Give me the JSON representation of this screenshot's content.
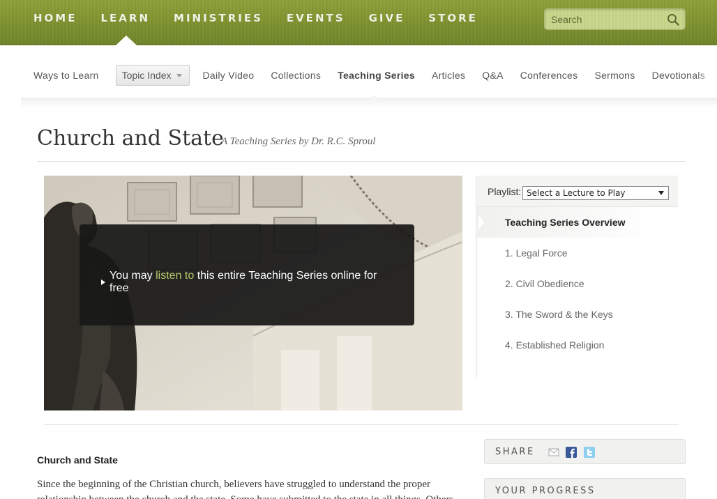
{
  "nav": {
    "items": [
      "HOME",
      "LEARN",
      "MINISTRIES",
      "EVENTS",
      "GIVE",
      "STORE"
    ],
    "search_placeholder": "Search"
  },
  "subnav": {
    "ways": "Ways to Learn",
    "topic": "Topic Index",
    "daily": "Daily Video",
    "collections": "Collections",
    "series": "Teaching Series",
    "articles": "Articles",
    "qa": "Q&A",
    "conferences": "Conferences",
    "sermons": "Sermons",
    "devotionals": "Devotionals"
  },
  "page": {
    "title": "Church and State",
    "subtitle": "A Teaching Series by Dr. R.C. Sproul"
  },
  "media": {
    "msg_pre": "You may ",
    "msg_link": "listen to",
    "msg_post": " this entire Teaching Series online for free"
  },
  "playlist": {
    "label": "Playlist:",
    "select_value": "Select a Lecture to Play",
    "overview": "Teaching Series Overview",
    "items": [
      "1. Legal Force",
      "2. Civil Obedience",
      "3. The Sword & the Keys",
      "4. Established Religion"
    ]
  },
  "body": {
    "title": "Church and State",
    "text": "Since the beginning of the Christian church, believers have struggled to understand the proper relationship between the church and the state. Some have submitted to the state in all things. Others"
  },
  "sidebar": {
    "share": "SHARE",
    "progress": "YOUR PROGRESS"
  },
  "colors": {
    "nav_green": "#7f9430",
    "link_green": "#b6cc6a"
  }
}
